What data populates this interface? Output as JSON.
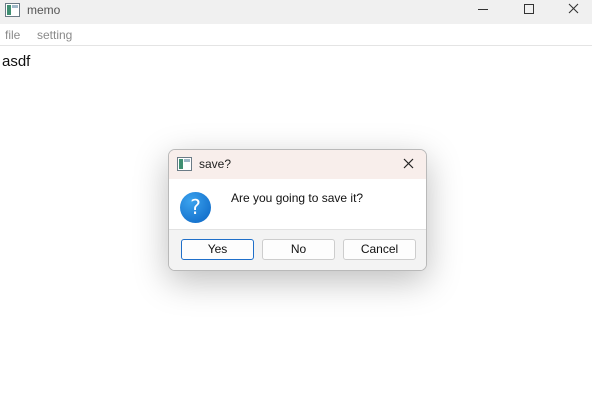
{
  "window": {
    "title": "memo",
    "icon": "app-window-icon",
    "controls": [
      "minimize-icon",
      "maximize-icon",
      "close-icon"
    ]
  },
  "menubar": {
    "items": [
      {
        "label": "file"
      },
      {
        "label": "setting"
      }
    ]
  },
  "editor": {
    "content": "asdf"
  },
  "dialog": {
    "title": "save?",
    "icon": "question-icon",
    "icon_glyph": "?",
    "message": "Are you going to save it?",
    "buttons": {
      "yes": "Yes",
      "no": "No",
      "cancel": "Cancel"
    },
    "default_button": "Yes"
  },
  "colors": {
    "accent": "#1f6fc9",
    "dialog_titlebar": "#f8eeeb",
    "question_icon": "#1a7fdc"
  }
}
